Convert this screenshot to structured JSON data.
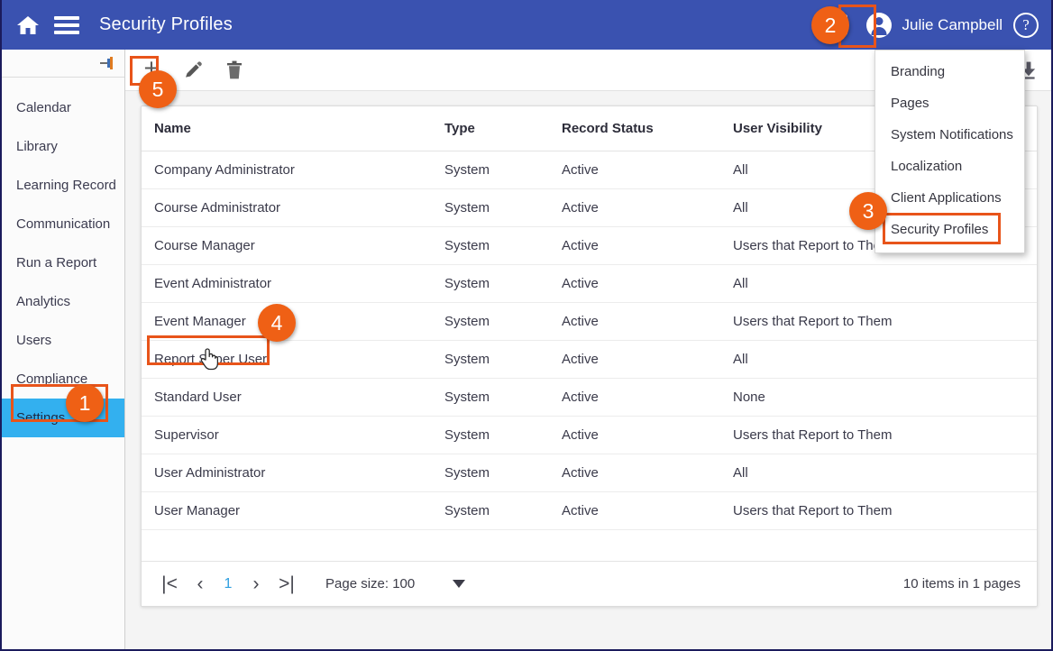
{
  "header": {
    "title": "Security Profiles",
    "home_icon": "home-icon",
    "menu_icon": "hamburger-icon",
    "kebab_icon": "vertical-ellipsis-icon",
    "user_name": "Julie Campbell",
    "avatar_icon": "user-avatar-icon",
    "help_icon": "question-mark-icon",
    "bg_color": "#3a52b0"
  },
  "sidebar": {
    "pin_icon": "pin-icon",
    "items": [
      {
        "label": "Calendar",
        "active": false
      },
      {
        "label": "Library",
        "active": false
      },
      {
        "label": "Learning Record",
        "active": false
      },
      {
        "label": "Communication",
        "active": false
      },
      {
        "label": "Run a Report",
        "active": false
      },
      {
        "label": "Analytics",
        "active": false
      },
      {
        "label": "Users",
        "active": false
      },
      {
        "label": "Compliance",
        "active": false
      },
      {
        "label": "Settings",
        "active": true
      }
    ],
    "active_color": "#33b0ef"
  },
  "toolbar": {
    "add_label": "+",
    "add_icon": "plus-icon",
    "edit_icon": "pencil-icon",
    "delete_icon": "trash-icon",
    "download_icon": "download-icon"
  },
  "dropdown": {
    "items": [
      {
        "label": "Branding"
      },
      {
        "label": "Pages"
      },
      {
        "label": "System Notifications"
      },
      {
        "label": "Localization"
      },
      {
        "label": "Client Applications"
      },
      {
        "label": "Security Profiles"
      }
    ]
  },
  "grid": {
    "columns": [
      "Name",
      "Type",
      "Record Status",
      "User Visibility"
    ],
    "rows": [
      {
        "name": "Company Administrator",
        "type": "System",
        "status": "Active",
        "visibility": "All"
      },
      {
        "name": "Course Administrator",
        "type": "System",
        "status": "Active",
        "visibility": "All"
      },
      {
        "name": "Course Manager",
        "type": "System",
        "status": "Active",
        "visibility": "Users that Report to Them"
      },
      {
        "name": "Event Administrator",
        "type": "System",
        "status": "Active",
        "visibility": "All"
      },
      {
        "name": "Event Manager",
        "type": "System",
        "status": "Active",
        "visibility": "Users that Report to Them"
      },
      {
        "name": "Report Super User",
        "type": "System",
        "status": "Active",
        "visibility": "All"
      },
      {
        "name": "Standard User",
        "type": "System",
        "status": "Active",
        "visibility": "None"
      },
      {
        "name": "Supervisor",
        "type": "System",
        "status": "Active",
        "visibility": "Users that Report to Them"
      },
      {
        "name": "User Administrator",
        "type": "System",
        "status": "Active",
        "visibility": "All"
      },
      {
        "name": "User Manager",
        "type": "System",
        "status": "Active",
        "visibility": "Users that Report to Them"
      }
    ]
  },
  "pagination": {
    "first_label": "|<",
    "prev_label": "‹",
    "page_label": "1",
    "next_label": "›",
    "last_label": ">|",
    "page_size_label": "Page size: 100",
    "summary": "10 items in 1 pages"
  },
  "callouts": {
    "accent_color": "#ef6015",
    "steps": [
      {
        "number": "1",
        "target": "sidebar-item-settings"
      },
      {
        "number": "2",
        "target": "kebab-menu-button"
      },
      {
        "number": "3",
        "target": "dropdown-item-security-profiles"
      },
      {
        "number": "4",
        "target": "table-row-report-super-user"
      },
      {
        "number": "5",
        "target": "add-button"
      }
    ]
  }
}
